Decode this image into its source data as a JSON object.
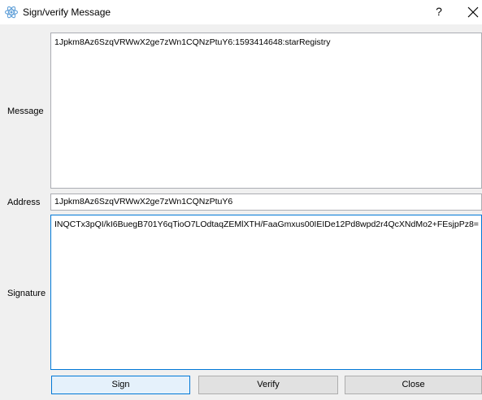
{
  "window": {
    "title": "Sign/verify Message",
    "help_label": "?"
  },
  "form": {
    "message_label": "Message",
    "message_value": "1Jpkm8Az6SzqVRWwX2ge7zWn1CQNzPtuY6:1593414648:starRegistry",
    "address_label": "Address",
    "address_value": "1Jpkm8Az6SzqVRWwX2ge7zWn1CQNzPtuY6",
    "signature_label": "Signature",
    "signature_value": "INQCTx3pQI/kI6BuegB701Y6qTioO7LOdtaqZEMlXTH/FaaGmxus00IEIDe12Pd8wpd2r4QcXNdMo2+FEsjpPz8="
  },
  "buttons": {
    "sign_label": "Sign",
    "verify_label": "Verify",
    "close_label": "Close"
  },
  "colors": {
    "accent": "#0078d7",
    "field_border": "#abadb3",
    "button_face": "#e1e1e1"
  },
  "icons": {
    "app": "react-atom-icon",
    "close": "close-icon"
  }
}
